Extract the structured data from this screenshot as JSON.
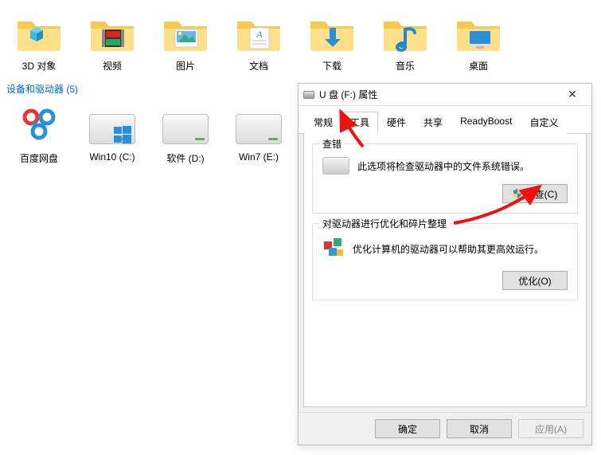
{
  "explorer": {
    "group_label": "设备和驱动器 (5)",
    "folders": [
      {
        "name": "3D 对象",
        "icon": "3d-cube"
      },
      {
        "name": "视频",
        "icon": "video"
      },
      {
        "name": "图片",
        "icon": "pictures"
      },
      {
        "name": "文档",
        "icon": "documents"
      },
      {
        "name": "下载",
        "icon": "downloads"
      },
      {
        "name": "音乐",
        "icon": "music"
      },
      {
        "name": "桌面",
        "icon": "desktop"
      }
    ],
    "drives": [
      {
        "name": "百度网盘",
        "icon": "baidu"
      },
      {
        "name": "Win10 (C:)",
        "icon": "win10"
      },
      {
        "name": "软件 (D:)",
        "icon": "drive"
      },
      {
        "name": "Win7 (E:)",
        "icon": "drive"
      }
    ]
  },
  "dialog": {
    "title": "U 盘 (F:) 属性",
    "tabs": {
      "general": "常规",
      "tools": "工具",
      "hardware": "硬件",
      "sharing": "共享",
      "readyboost": "ReadyBoost",
      "customize": "自定义"
    },
    "active_tab": "tools",
    "error_check": {
      "legend": "查错",
      "desc": "此选项将检查驱动器中的文件系统错误。",
      "button": "检查(C)"
    },
    "defrag": {
      "legend": "对驱动器进行优化和碎片整理",
      "desc": "优化计算机的驱动器可以帮助其更高效运行。",
      "button": "优化(O)"
    },
    "buttons": {
      "ok": "确定",
      "cancel": "取消",
      "apply": "应用(A)"
    }
  }
}
